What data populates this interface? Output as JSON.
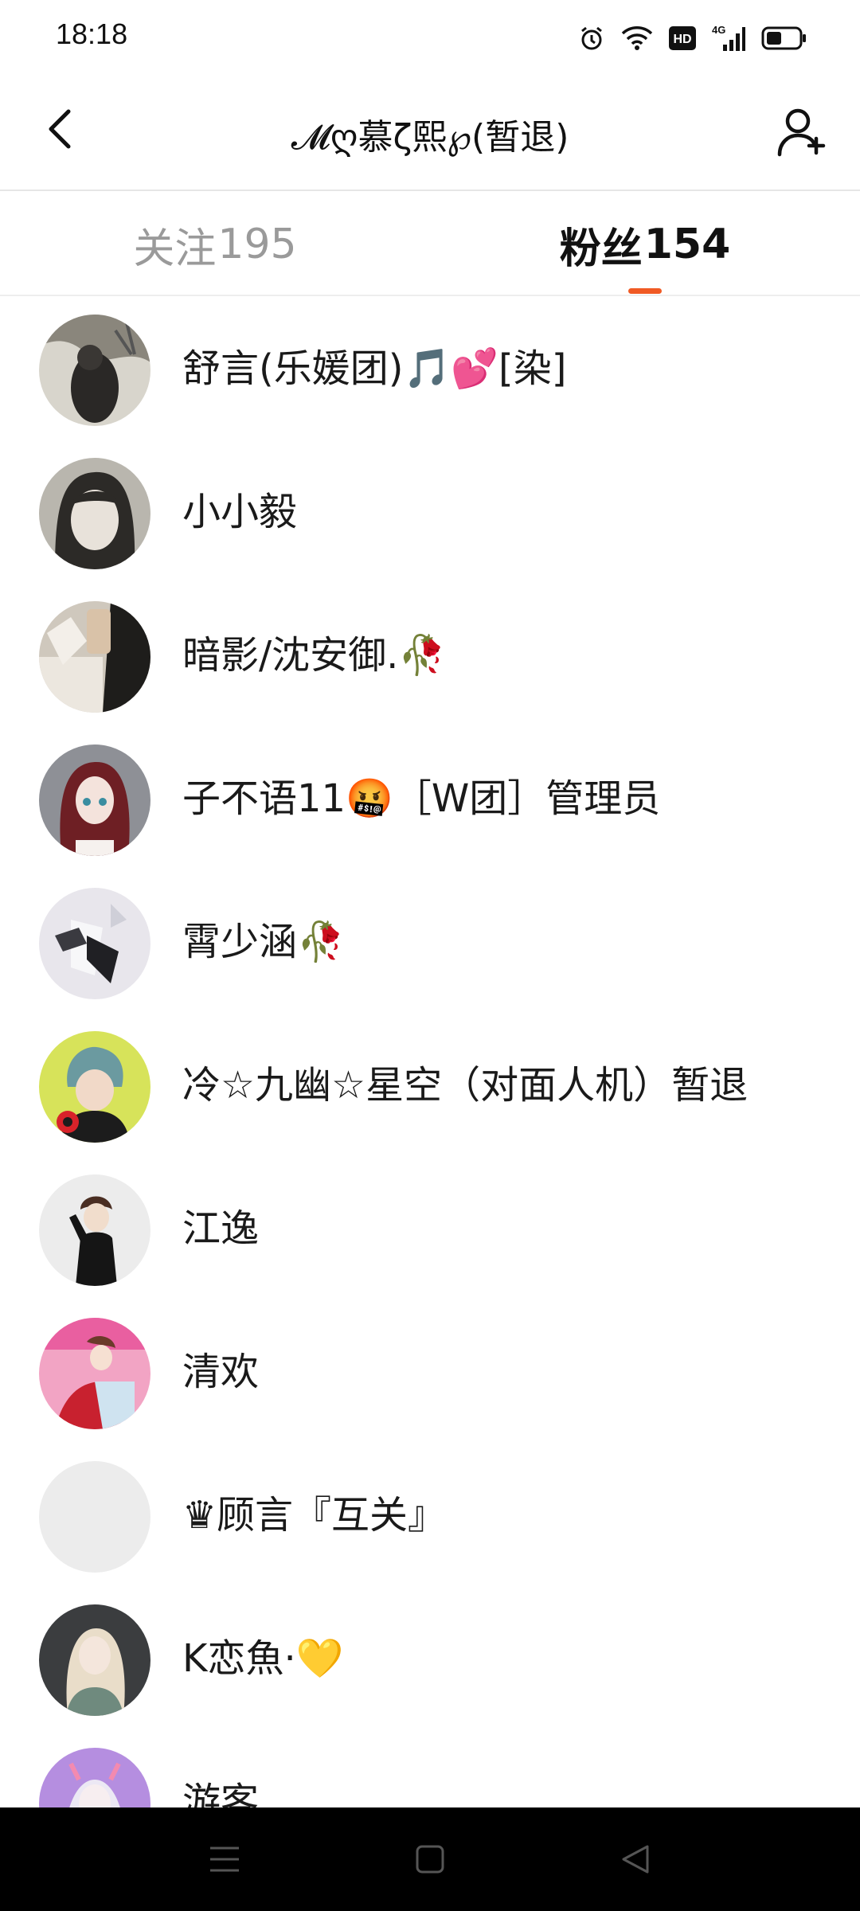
{
  "status_bar": {
    "time": "18:18",
    "icons": [
      "alarm-icon",
      "wifi-icon",
      "hd-icon",
      "signal-4g-icon",
      "battery-icon"
    ],
    "hd_label": "HD",
    "network_label": "4G"
  },
  "header": {
    "title": "𝓜ღ慕ζ熙℘(暂退)"
  },
  "tabs": [
    {
      "label": "关注",
      "count": "195",
      "active": false
    },
    {
      "label": "粉丝",
      "count": "154",
      "active": true
    }
  ],
  "accent_color": "#f05a24",
  "followers": [
    {
      "name": "舒言(乐媛团)🎵💕[染]"
    },
    {
      "name": "小小毅"
    },
    {
      "name": "暗影/沈安御.🥀"
    },
    {
      "name": "子不语11🤬［W团］管理员"
    },
    {
      "name": "霄少涵🥀"
    },
    {
      "name": "冷☆九幽☆星空（对面人机）暂退"
    },
    {
      "name": "江逸"
    },
    {
      "name": "清欢"
    },
    {
      "name": "♛顾言『互关』"
    },
    {
      "name": "K恋魚·💛"
    },
    {
      "name": "游客"
    }
  ]
}
